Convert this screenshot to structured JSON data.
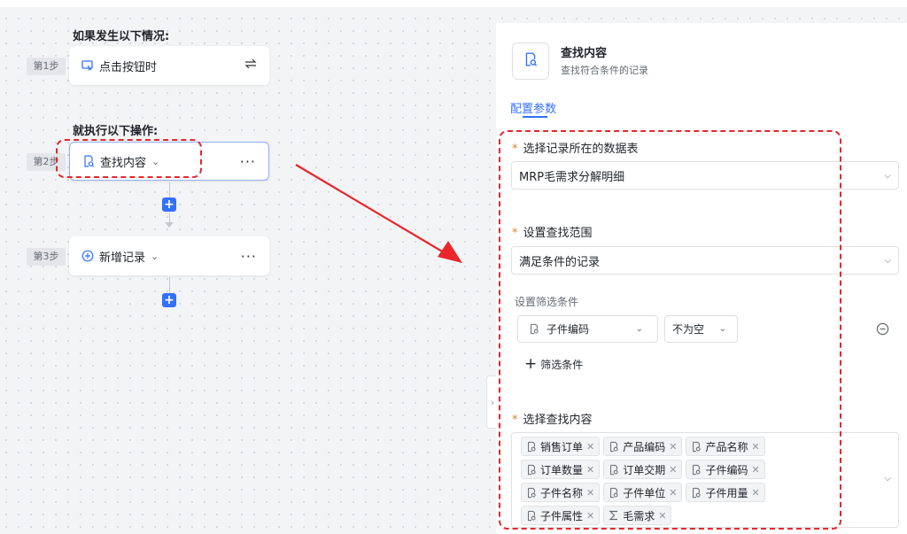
{
  "canvas": {
    "trigger_title": "如果发生以下情况:",
    "action_title": "就执行以下操作:",
    "steps": [
      {
        "badge": "第1步",
        "label": "点击按钮时",
        "icon": "click-icon"
      },
      {
        "badge": "第2步",
        "label": "查找内容",
        "icon": "find-record-icon"
      },
      {
        "badge": "第3步",
        "label": "新增记录",
        "icon": "add-circle-icon"
      }
    ],
    "more_label": "···",
    "plus_label": "+"
  },
  "panel": {
    "title": "查找内容",
    "subtitle": "查找符合条件的记录",
    "tab_label": "配置参数",
    "table_field": {
      "label": "选择记录所在的数据表",
      "value": "MRP毛需求分解明细"
    },
    "range_field": {
      "label": "设置查找范围",
      "value": "满足条件的记录"
    },
    "filter": {
      "label": "设置筛选条件",
      "field_value": "子件编码",
      "operator_value": "不为空",
      "add_label": "筛选条件"
    },
    "content_field": {
      "label": "选择查找内容",
      "tags": [
        {
          "label": "销售订单",
          "icon": "field-icon"
        },
        {
          "label": "产品编码",
          "icon": "field-icon"
        },
        {
          "label": "产品名称",
          "icon": "field-icon"
        },
        {
          "label": "订单数量",
          "icon": "field-icon"
        },
        {
          "label": "订单交期",
          "icon": "field-icon"
        },
        {
          "label": "子件编码",
          "icon": "field-icon"
        },
        {
          "label": "子件名称",
          "icon": "field-icon"
        },
        {
          "label": "子件单位",
          "icon": "field-icon"
        },
        {
          "label": "子件用量",
          "icon": "field-icon"
        },
        {
          "label": "子件属性",
          "icon": "field-icon"
        },
        {
          "label": "毛需求",
          "icon": "sum-icon"
        }
      ]
    }
  },
  "colors": {
    "accent": "#3370ff",
    "annotation": "#e8262b",
    "required": "#e07f2a"
  }
}
